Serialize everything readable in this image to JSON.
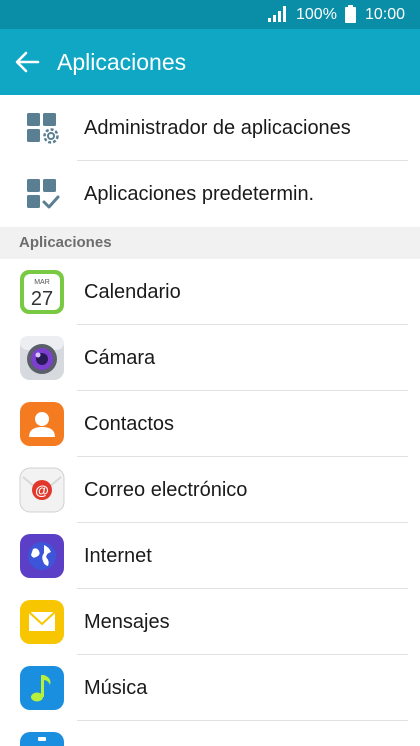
{
  "status_bar": {
    "battery_percent": "100%",
    "time": "10:00",
    "signal_icon": "signal-icon",
    "battery_icon": "battery-icon"
  },
  "app_bar": {
    "title": "Aplicaciones",
    "back_icon": "arrow-back-icon"
  },
  "top_items": [
    {
      "label": "Administrador de aplicaciones",
      "icon": "apps-settings-icon"
    },
    {
      "label": "Aplicaciones predetermin.",
      "icon": "apps-default-icon"
    }
  ],
  "section": {
    "title": "Aplicaciones"
  },
  "apps": [
    {
      "label": "Calendario",
      "icon": "calendar-icon",
      "month": "MAR",
      "day": "27"
    },
    {
      "label": "Cámara",
      "icon": "camera-icon"
    },
    {
      "label": "Contactos",
      "icon": "contacts-icon"
    },
    {
      "label": "Correo electrónico",
      "icon": "email-icon"
    },
    {
      "label": "Internet",
      "icon": "internet-icon"
    },
    {
      "label": "Mensajes",
      "icon": "messages-icon"
    },
    {
      "label": "Música",
      "icon": "music-icon"
    }
  ],
  "colors": {
    "status_bar": "#0a8ea8",
    "app_bar": "#0fa7c4",
    "section_bg": "#f1f1f1"
  }
}
